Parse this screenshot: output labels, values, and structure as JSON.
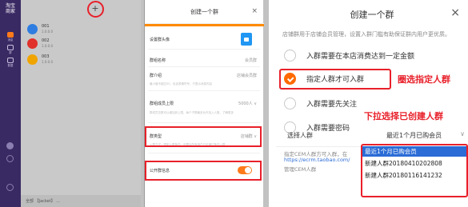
{
  "left": {
    "logo": "淘宝\n商家",
    "sidebar_items": [
      {
        "label": "消息",
        "active": true
      },
      {
        "label": "群",
        "active": false
      },
      {
        "label": "数据",
        "active": false
      }
    ],
    "conversations": [
      {
        "name": "001",
        "sub": "1.0.0.0",
        "color": "#2f7de1"
      },
      {
        "name": "002",
        "sub": "1.0.0.0",
        "color": "#e0312a"
      },
      {
        "name": "003",
        "sub": "1.0.0.0",
        "color": "#f0a400"
      }
    ],
    "bottom_text": "全部 【Jacket】 ...",
    "modal": {
      "title": "创建一个群",
      "close": "×",
      "rows": [
        {
          "key": "设置群头像",
          "value": ""
        },
        {
          "key": "群组名称",
          "value": "会员群"
        },
        {
          "key": "群介绍",
          "value": "店铺会员群",
          "hint": "最小值不超过30，包含表情符号，只表示消息内容"
        },
        {
          "key": "群组成员上限",
          "value": "5000人 ∨",
          "hint": "群成员总数可以增加到上限，每个子群最多允许加入人数，了解更多"
        },
        {
          "key": "群类型",
          "value": "店铺群 ∨",
          "hint": "入群方式：限制入群条件，设置后所有用户只可通过条件入群"
        },
        {
          "key": "公开群信息",
          "value": ""
        }
      ]
    }
  },
  "right": {
    "title": "创建一个群",
    "close": "×",
    "description": "店铺群用于店铺会员管理，设置入群门槛有助保证群内用户更优质。",
    "options": [
      {
        "label": "入群需要在本店消费达到一定金额",
        "selected": false
      },
      {
        "label": "指定人群才可入群",
        "selected": true
      },
      {
        "label": "入群需要先关注",
        "selected": false
      },
      {
        "label": "入群需要密码",
        "selected": false
      }
    ],
    "annotation_select_crowd": "圈选指定人群",
    "annotation_dropdown": "下拉选择已创建人群",
    "select": {
      "label": "选择人群",
      "value": "最近1个月已购会员",
      "caret": "∨"
    },
    "select_desc": [
      "指定CEM人群方可入群，在",
      "https://ecrm.taobao.com/",
      "管理CEM人群"
    ],
    "dropdown_options": [
      {
        "label": "最近1个月已购会员",
        "selected": true
      },
      {
        "label": "新建人群20180410202808",
        "selected": false
      },
      {
        "label": "新建人群20180116141232",
        "selected": false
      }
    ]
  }
}
